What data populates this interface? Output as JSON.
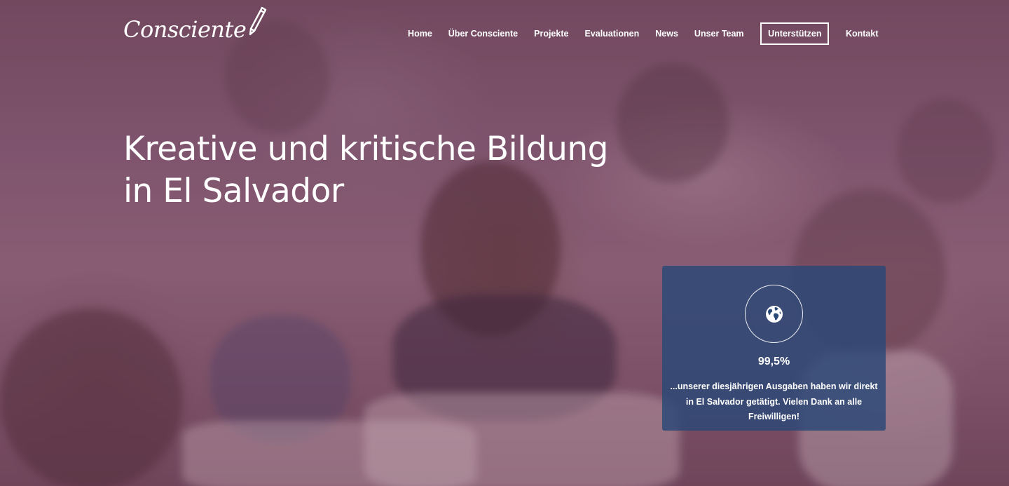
{
  "header": {
    "logo_text": "Consciente",
    "logo_icon": "pencil-icon"
  },
  "nav": {
    "items": [
      {
        "label": "Home"
      },
      {
        "label": "Über Consciente"
      },
      {
        "label": "Projekte"
      },
      {
        "label": "Evaluationen"
      },
      {
        "label": "News"
      },
      {
        "label": "Unser Team"
      },
      {
        "label": "Unterstützen",
        "style": "boxed"
      },
      {
        "label": "Kontakt"
      }
    ]
  },
  "hero": {
    "headline_line1": "Kreative und kritische Bildung",
    "headline_line2": "in El Salvador",
    "overlay_color": "#824664"
  },
  "stat_card": {
    "icon": "globe-icon",
    "value": "99,5%",
    "text": "...unserer diesjährigen Ausgaben haben wir direkt in El Salvador getätigt. Vielen Dank an alle Freiwilligen!",
    "background_color": "#2a4876"
  }
}
